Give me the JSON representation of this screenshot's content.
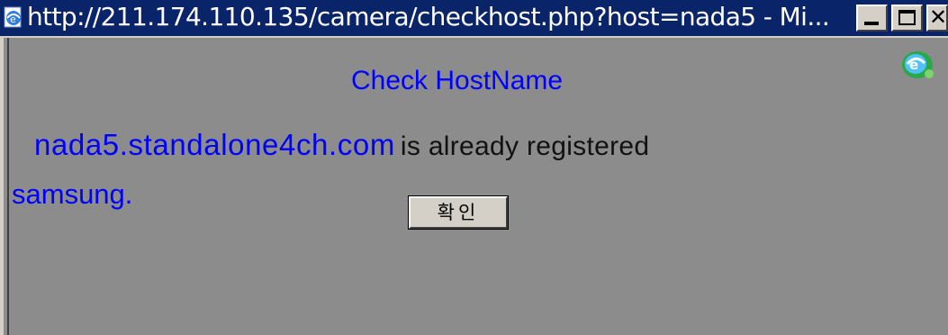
{
  "window": {
    "title": "http://211.174.110.135/camera/checkhost.php?host=nada5 - Mi...",
    "controls": {
      "minimize_icon": "minimize-icon",
      "maximize_icon": "maximize-icon",
      "close_glyph": "✕"
    },
    "title_icon": "ie-page-icon"
  },
  "dialog": {
    "heading": "Check HostName",
    "hostname": "nada5.standalone4ch.com",
    "status_text": "is already registered",
    "suffix": "samsung.",
    "ok_button_label": "확인"
  },
  "colors": {
    "titlebar": "#0a246a",
    "background": "#8c8c8c",
    "link_blue": "#0000ff"
  }
}
